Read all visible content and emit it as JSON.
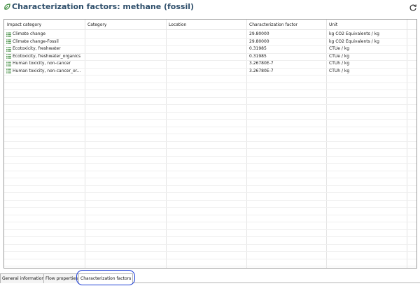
{
  "header": {
    "title": "Characterization factors: methane (fossil)",
    "icon": "leaf-icon",
    "refresh_icon": "refresh-icon"
  },
  "table": {
    "columns": [
      "Impact category",
      "Category",
      "Location",
      "Characterization factor",
      "Unit"
    ],
    "rows": [
      {
        "impact_category": "Climate change",
        "category": "",
        "location": "",
        "factor": "29.80000",
        "unit": "kg CO2 Equivalents / kg"
      },
      {
        "impact_category": "Climate change-Fossil",
        "category": "",
        "location": "",
        "factor": "29.80000",
        "unit": "kg CO2 Equivalents / kg"
      },
      {
        "impact_category": "Ecotoxicity, freshwater",
        "category": "",
        "location": "",
        "factor": "0.31985",
        "unit": "CTUe / kg"
      },
      {
        "impact_category": "Ecotoxicity, freshwater_organics",
        "category": "",
        "location": "",
        "factor": "0.31985",
        "unit": "CTUe / kg"
      },
      {
        "impact_category": "Human toxicity, non-cancer",
        "category": "",
        "location": "",
        "factor": "3.26780E-7",
        "unit": "CTUh / kg"
      },
      {
        "impact_category": "Human toxicity, non-cancer_or...",
        "category": "",
        "location": "",
        "factor": "3.26780E-7",
        "unit": "CTUh / kg"
      }
    ],
    "row_icon": "impact-category-icon"
  },
  "tabs": [
    {
      "label": "General information",
      "active": false
    },
    {
      "label": "Flow properties",
      "active": false
    },
    {
      "label": "Characterization factors",
      "active": true
    }
  ],
  "colors": {
    "title": "#2f4f6b",
    "row_icon": "#3c8a3c",
    "tab_highlight": "#1e3fd6"
  }
}
